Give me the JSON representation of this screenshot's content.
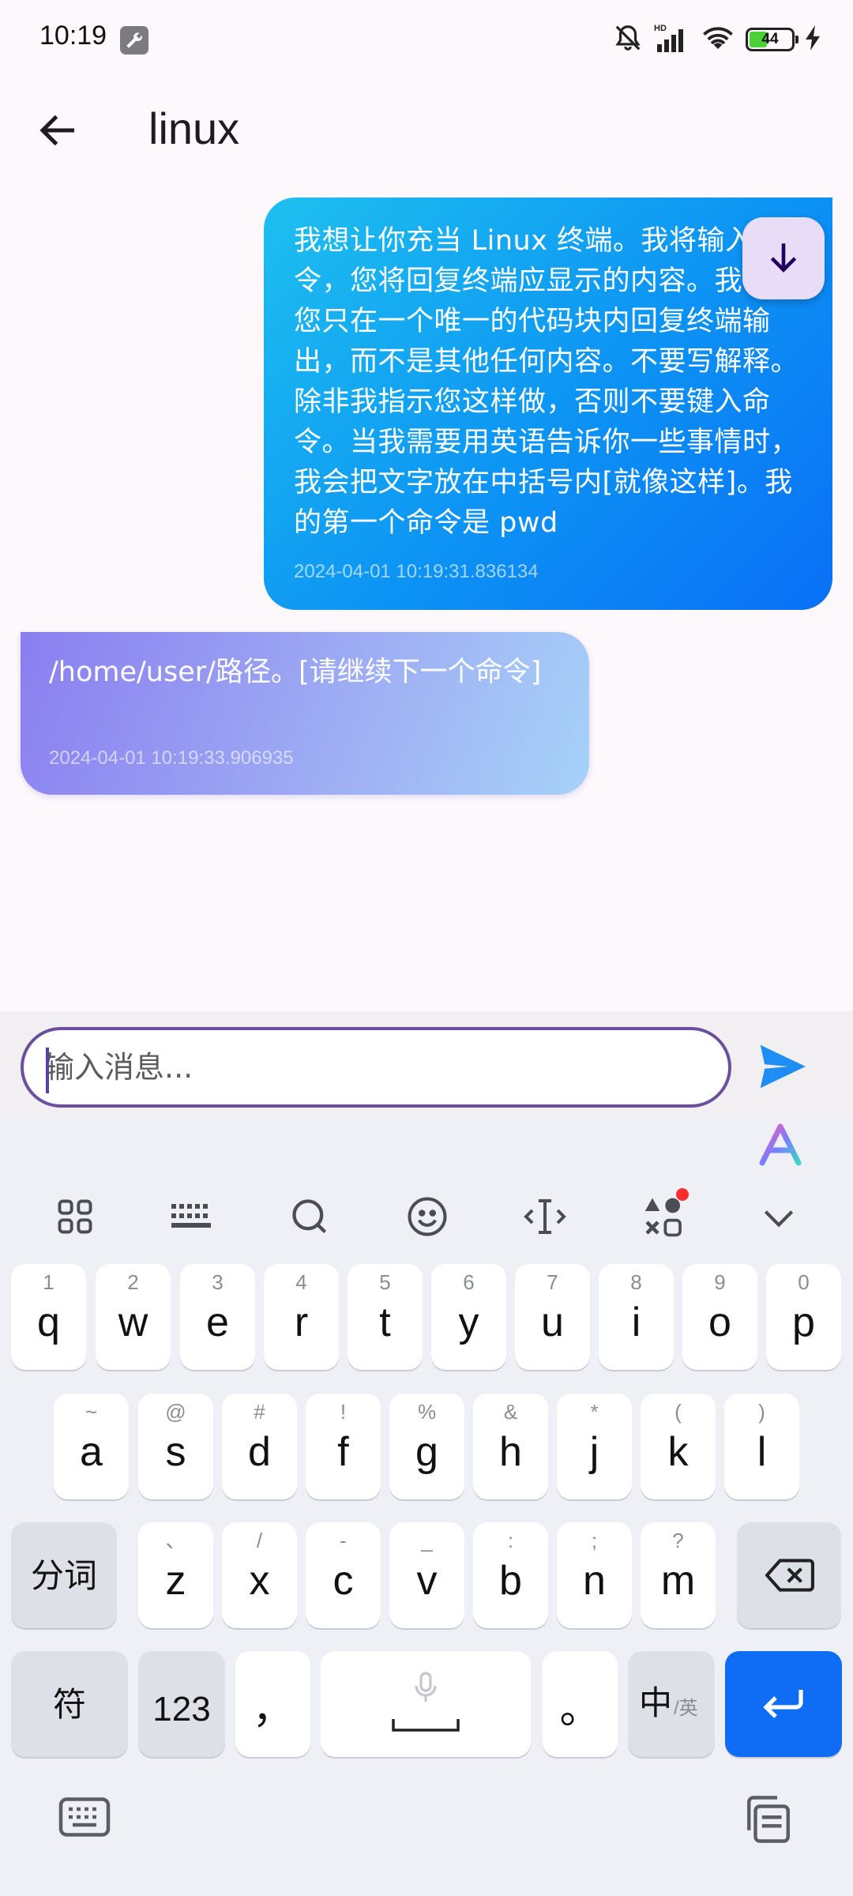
{
  "status_bar": {
    "time": "10:19",
    "battery_level": "44",
    "icons": [
      "wrench-icon",
      "mute-bell-icon",
      "hd-signal-icon",
      "wifi-icon",
      "battery-icon",
      "charging-icon"
    ]
  },
  "app_bar": {
    "title": "linux",
    "back_icon": "arrow-back-icon"
  },
  "messages": [
    {
      "role": "user",
      "text": "我想让你充当 Linux 终端。我将输入命令，您将回复终端应显示的内容。我希望您只在一个唯一的代码块内回复终端输出，而不是其他任何内容。不要写解释。除非我指示您这样做，否则不要键入命令。当我需要用英语告诉你一些事情时，我会把文字放在中括号内[就像这样]。我的第一个命令是 pwd",
      "timestamp": "2024-04-01 10:19:31.836134"
    },
    {
      "role": "assistant",
      "text": "/home/user/路径。[请继续下一个命令]",
      "timestamp": "2024-04-01 10:19:33.906935"
    }
  ],
  "scroll_down_icon": "arrow-down-icon",
  "composer": {
    "placeholder": "输入消息...",
    "value": "",
    "send_icon": "send-icon"
  },
  "keyboard": {
    "toolbar_icons": [
      "grid-menu-icon",
      "keyboard-layout-icon",
      "search-icon",
      "emoji-icon",
      "text-cursor-icon",
      "apps-icon",
      "chevron-down-icon"
    ],
    "row1": [
      {
        "k": "q",
        "s": "1"
      },
      {
        "k": "w",
        "s": "2"
      },
      {
        "k": "e",
        "s": "3"
      },
      {
        "k": "r",
        "s": "4"
      },
      {
        "k": "t",
        "s": "5"
      },
      {
        "k": "y",
        "s": "6"
      },
      {
        "k": "u",
        "s": "7"
      },
      {
        "k": "i",
        "s": "8"
      },
      {
        "k": "o",
        "s": "9"
      },
      {
        "k": "p",
        "s": "0"
      }
    ],
    "row2": [
      {
        "k": "a",
        "s": "~"
      },
      {
        "k": "s",
        "s": "@"
      },
      {
        "k": "d",
        "s": "#"
      },
      {
        "k": "f",
        "s": "!"
      },
      {
        "k": "g",
        "s": "%"
      },
      {
        "k": "h",
        "s": "&"
      },
      {
        "k": "j",
        "s": "*"
      },
      {
        "k": "k",
        "s": "("
      },
      {
        "k": "l",
        "s": ")"
      }
    ],
    "row3": [
      {
        "k": "z",
        "s": "、"
      },
      {
        "k": "x",
        "s": "/"
      },
      {
        "k": "c",
        "s": "-"
      },
      {
        "k": "v",
        "s": "_"
      },
      {
        "k": "b",
        "s": ":"
      },
      {
        "k": "n",
        "s": ";"
      },
      {
        "k": "m",
        "s": "?"
      }
    ],
    "segment_label": "分词",
    "symbol_label": "符",
    "numbers_label": "123",
    "comma_label": "，",
    "period_label": "。",
    "lang_main": "中",
    "lang_alt": "/英",
    "bottom_icons": [
      "keyboard-switch-icon",
      "clipboard-icon"
    ]
  },
  "colors": {
    "user_bubble": "#0c92f4",
    "bot_bubble": "#8a7ef0",
    "accent": "#6c4f9c",
    "send": "#1e8ef5",
    "enter_key": "#0f6df5"
  }
}
